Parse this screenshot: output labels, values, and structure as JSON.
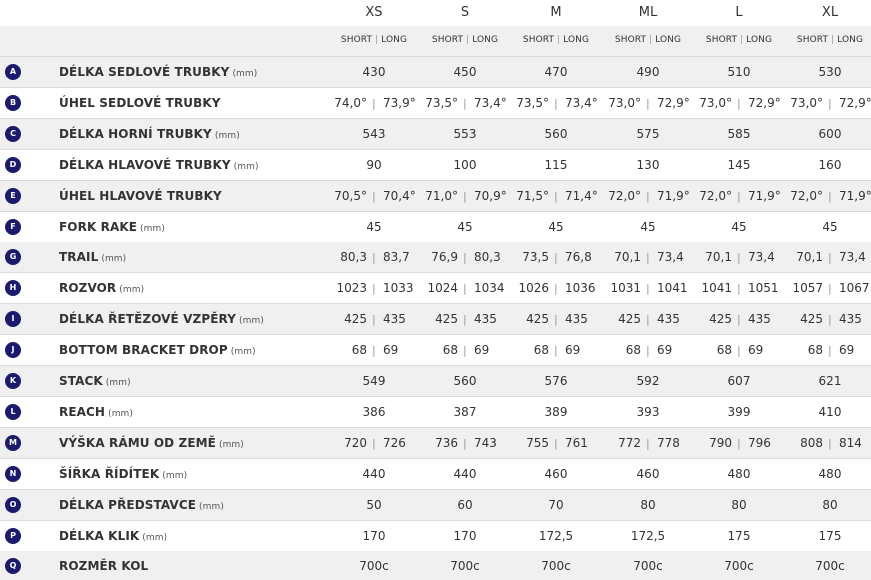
{
  "sizes": [
    "XS",
    "S",
    "M",
    "ML",
    "L",
    "XL"
  ],
  "sub_headers": {
    "short": "SHORT",
    "long": "LONG"
  },
  "colors": {
    "badge": "#1c1a6e",
    "row_alt": "#f0f0f0",
    "border": "#dcdcdc"
  },
  "rows": [
    {
      "letter": "A",
      "label": "DÉLKA SEDLOVÉ TRUBKY",
      "unit": "(mm)",
      "values": [
        "430",
        "450",
        "470",
        "490",
        "510",
        "530"
      ]
    },
    {
      "letter": "B",
      "label": "ÚHEL SEDLOVÉ TRUBKY",
      "unit": "",
      "values": [
        [
          "74,0°",
          "73,9°"
        ],
        [
          "73,5°",
          "73,4°"
        ],
        [
          "73,5°",
          "73,4°"
        ],
        [
          "73,0°",
          "72,9°"
        ],
        [
          "73,0°",
          "72,9°"
        ],
        [
          "73,0°",
          "72,9°"
        ]
      ]
    },
    {
      "letter": "C",
      "label": "DÉLKA HORNÍ TRUBKY",
      "unit": "(mm)",
      "values": [
        "543",
        "553",
        "560",
        "575",
        "585",
        "600"
      ]
    },
    {
      "letter": "D",
      "label": "DÉLKA HLAVOVÉ TRUBKY",
      "unit": "(mm)",
      "values": [
        "90",
        "100",
        "115",
        "130",
        "145",
        "160"
      ]
    },
    {
      "letter": "E",
      "label": "ÚHEL HLAVOVÉ TRUBKY",
      "unit": "",
      "values": [
        [
          "70,5°",
          "70,4°"
        ],
        [
          "71,0°",
          "70,9°"
        ],
        [
          "71,5°",
          "71,4°"
        ],
        [
          "72,0°",
          "71,9°"
        ],
        [
          "72,0°",
          "71,9°"
        ],
        [
          "72,0°",
          "71,9°"
        ]
      ]
    },
    {
      "letter": "F",
      "label": "FORK RAKE",
      "unit": "(mm)",
      "values": [
        "45",
        "45",
        "45",
        "45",
        "45",
        "45"
      ]
    },
    {
      "letter": "G",
      "label": "TRAIL",
      "unit": "(mm)",
      "values": [
        [
          "80,3",
          "83,7"
        ],
        [
          "76,9",
          "80,3"
        ],
        [
          "73,5",
          "76,8"
        ],
        [
          "70,1",
          "73,4"
        ],
        [
          "70,1",
          "73,4"
        ],
        [
          "70,1",
          "73,4"
        ]
      ]
    },
    {
      "letter": "H",
      "label": "ROZVOR",
      "unit": "(mm)",
      "values": [
        [
          "1023",
          "1033"
        ],
        [
          "1024",
          "1034"
        ],
        [
          "1026",
          "1036"
        ],
        [
          "1031",
          "1041"
        ],
        [
          "1041",
          "1051"
        ],
        [
          "1057",
          "1067"
        ]
      ]
    },
    {
      "letter": "I",
      "label": "DÉLKA ŘETĚZOVÉ VZPĚRY",
      "unit": "(mm)",
      "values": [
        [
          "425",
          "435"
        ],
        [
          "425",
          "435"
        ],
        [
          "425",
          "435"
        ],
        [
          "425",
          "435"
        ],
        [
          "425",
          "435"
        ],
        [
          "425",
          "435"
        ]
      ]
    },
    {
      "letter": "J",
      "label": "BOTTOM BRACKET DROP",
      "unit": "(mm)",
      "values": [
        [
          "68",
          "69"
        ],
        [
          "68",
          "69"
        ],
        [
          "68",
          "69"
        ],
        [
          "68",
          "69"
        ],
        [
          "68",
          "69"
        ],
        [
          "68",
          "69"
        ]
      ]
    },
    {
      "letter": "K",
      "label": "STACK",
      "unit": "(mm)",
      "values": [
        "549",
        "560",
        "576",
        "592",
        "607",
        "621"
      ]
    },
    {
      "letter": "L",
      "label": "REACH",
      "unit": "(mm)",
      "values": [
        "386",
        "387",
        "389",
        "393",
        "399",
        "410"
      ]
    },
    {
      "letter": "M",
      "label": "VÝŠKA RÁMU OD ZEMĚ",
      "unit": "(mm)",
      "values": [
        [
          "720",
          "726"
        ],
        [
          "736",
          "743"
        ],
        [
          "755",
          "761"
        ],
        [
          "772",
          "778"
        ],
        [
          "790",
          "796"
        ],
        [
          "808",
          "814"
        ]
      ]
    },
    {
      "letter": "N",
      "label": "ŠÍŘKA ŘÍDÍTEK",
      "unit": "(mm)",
      "values": [
        "440",
        "440",
        "460",
        "460",
        "480",
        "480"
      ]
    },
    {
      "letter": "O",
      "label": "DÉLKA PŘEDSTAVCE",
      "unit": "(mm)",
      "values": [
        "50",
        "60",
        "70",
        "80",
        "80",
        "80"
      ]
    },
    {
      "letter": "P",
      "label": "DÉLKA KLIK",
      "unit": "(mm)",
      "values": [
        "170",
        "170",
        "172,5",
        "172,5",
        "175",
        "175"
      ]
    },
    {
      "letter": "Q",
      "label": "ROZMĚR KOL",
      "unit": "",
      "values": [
        "700c",
        "700c",
        "700c",
        "700c",
        "700c",
        "700c"
      ]
    }
  ]
}
